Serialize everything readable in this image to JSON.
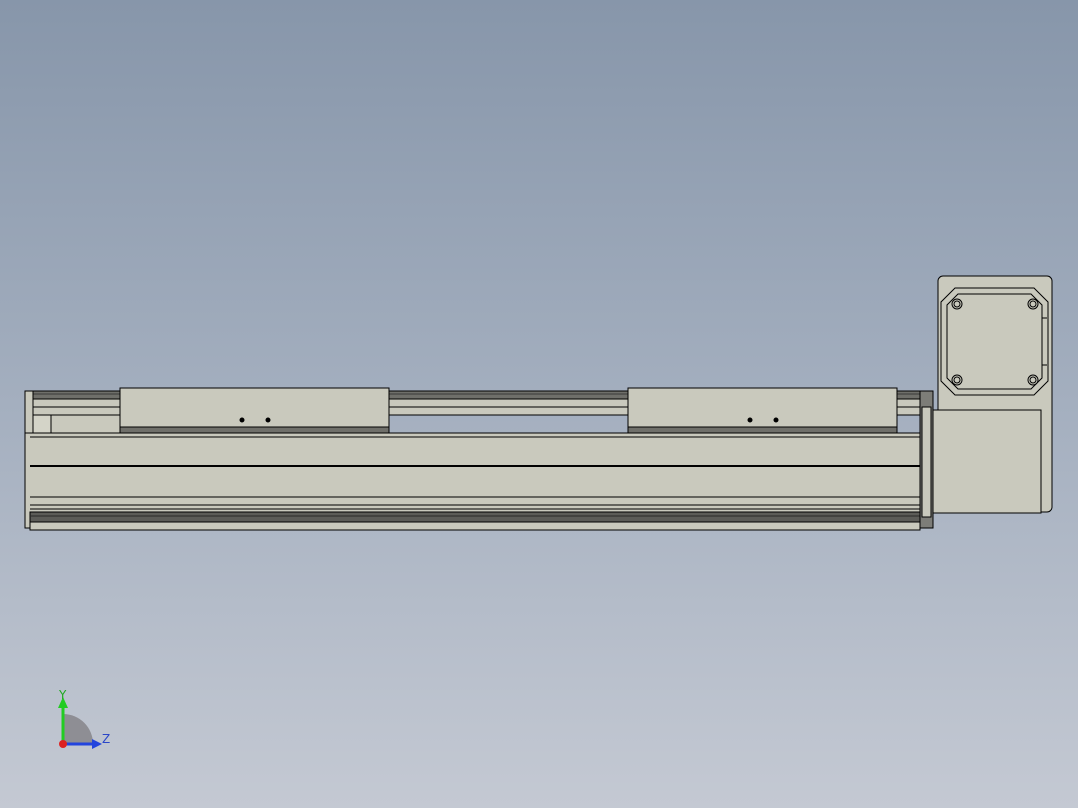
{
  "viewport": {
    "background_top": "#8796aa",
    "background_bottom": "#c4c9d3"
  },
  "model": {
    "component": "linear-actuator-with-motor",
    "body_color": "#c9c9bd",
    "edge_color": "#000000"
  },
  "triad": {
    "y_label": "Y",
    "z_label": "Z",
    "y_color": "#22cc22",
    "z_color": "#2244dd",
    "x_color": "#dd2222"
  }
}
